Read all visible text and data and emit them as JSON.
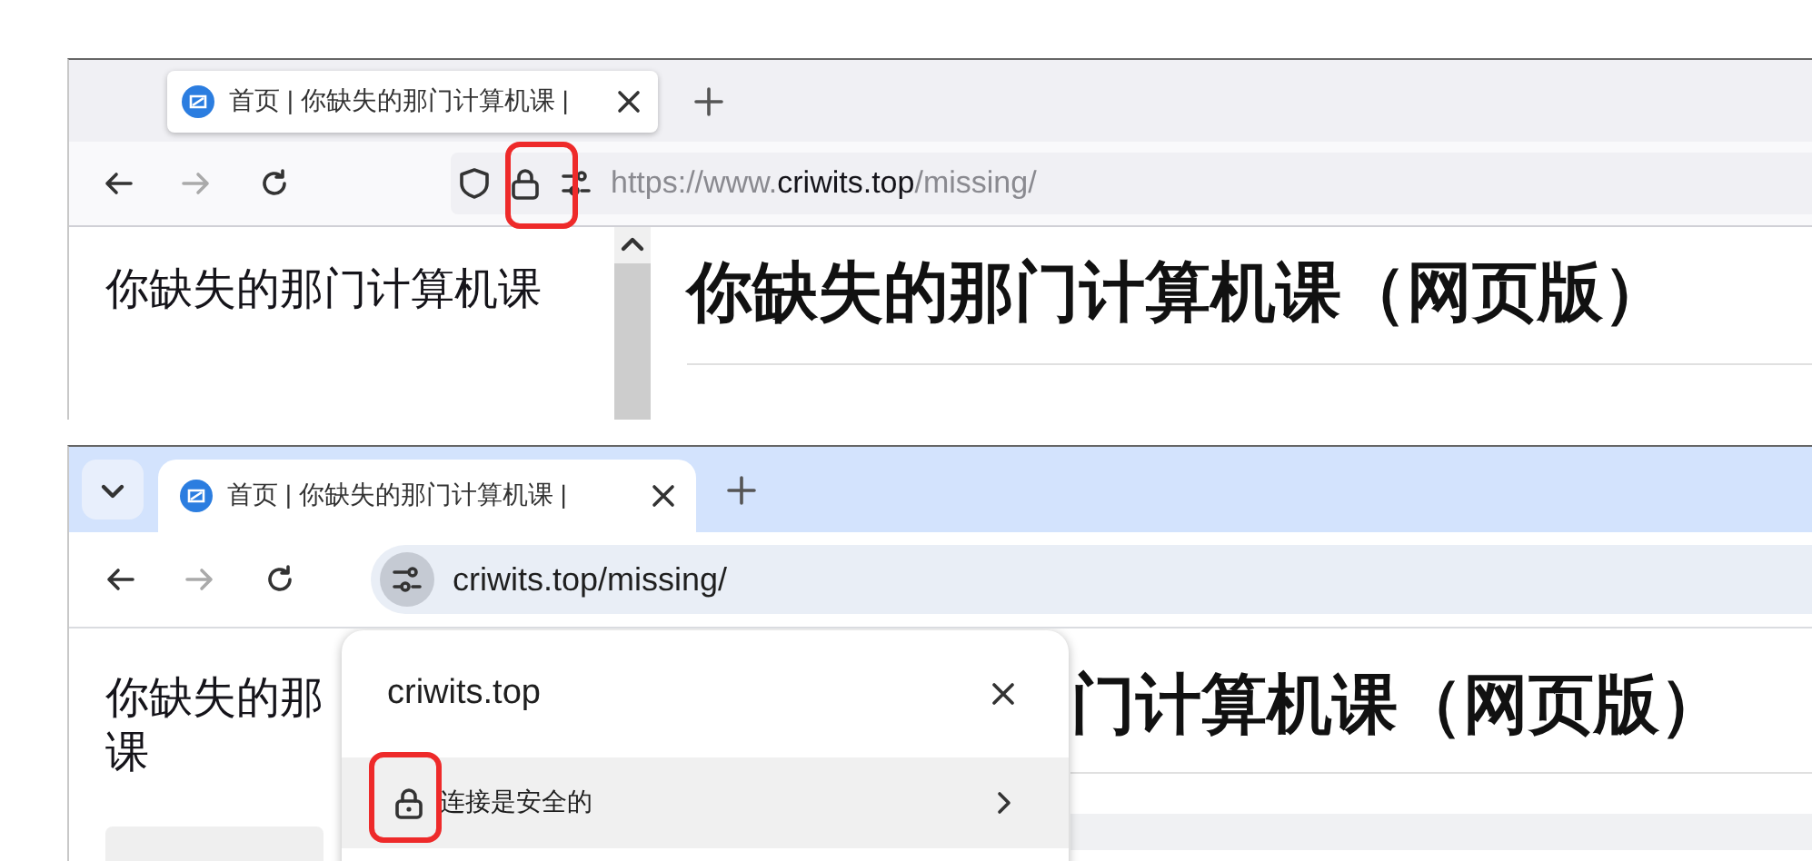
{
  "firefox_window": {
    "tab_title": "首页 | 你缺失的那门计算机课 |",
    "address": {
      "prefix": "https://www.",
      "domain": "criwits.top",
      "path": "/missing/"
    },
    "lock": {
      "highlighted": true
    },
    "sidebar_title": "你缺失的那门计算机课",
    "heading": "你缺失的那门计算机课（网页版）"
  },
  "chrome_window": {
    "tab_title": "首页 | 你缺失的那门计算机课 |",
    "address": "criwits.top/missing/",
    "sidebar_lines": [
      "你缺失的那",
      "课"
    ],
    "heading": "门计算机课（网页版）",
    "site_popup": {
      "title": "criwits.top",
      "rows": [
        {
          "label": "连接是安全的",
          "highlighted": true
        }
      ]
    }
  }
}
